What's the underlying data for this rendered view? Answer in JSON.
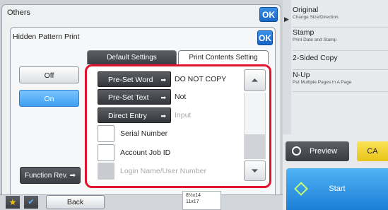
{
  "right_panel": {
    "items": [
      {
        "title": "Original",
        "subtitle": "Change Size/Direction."
      },
      {
        "title": "Stamp",
        "subtitle": "Print Date and Stamp"
      },
      {
        "title": "2-Sided Copy",
        "subtitle": ""
      },
      {
        "title": "N-Up",
        "subtitle": "Put Multiple Pages in A Page"
      }
    ]
  },
  "others_dialog": {
    "title": "Others",
    "ok_label": "OK"
  },
  "hidden_pattern_dialog": {
    "title": "Hidden Pattern Print",
    "ok_label": "OK",
    "tabs": [
      {
        "label": "Default Settings",
        "active": false
      },
      {
        "label": "Print Contents Setting",
        "active": true
      }
    ],
    "off_label": "Off",
    "on_label": "On",
    "selected": "On",
    "function_review_label": "Function Rev."
  },
  "contents": {
    "preset_word": {
      "label": "Pre-Set Word",
      "value": "DO NOT COPY"
    },
    "preset_text": {
      "label": "Pre-Set Text",
      "value": "Not"
    },
    "direct_entry": {
      "label": "Direct Entry",
      "placeholder": "Input"
    },
    "checkboxes": [
      {
        "label": "Serial Number",
        "checked": false,
        "enabled": true
      },
      {
        "label": "Account Job ID",
        "checked": false,
        "enabled": true
      },
      {
        "label": "Login Name/User Number",
        "checked": false,
        "enabled": false
      }
    ],
    "scroll_position": 0.7
  },
  "actions": {
    "preview_label": "Preview",
    "ca_label": "CA",
    "start_label": "Start"
  },
  "bottom_bar": {
    "back_label": "Back",
    "paper_sizes": [
      "8½x14",
      "11x17"
    ]
  },
  "colors": {
    "accent_blue": "#1766c7",
    "highlight_red": "#e0152d",
    "ca_yellow": "#e8c419",
    "start_blue": "#1c7fd6"
  }
}
